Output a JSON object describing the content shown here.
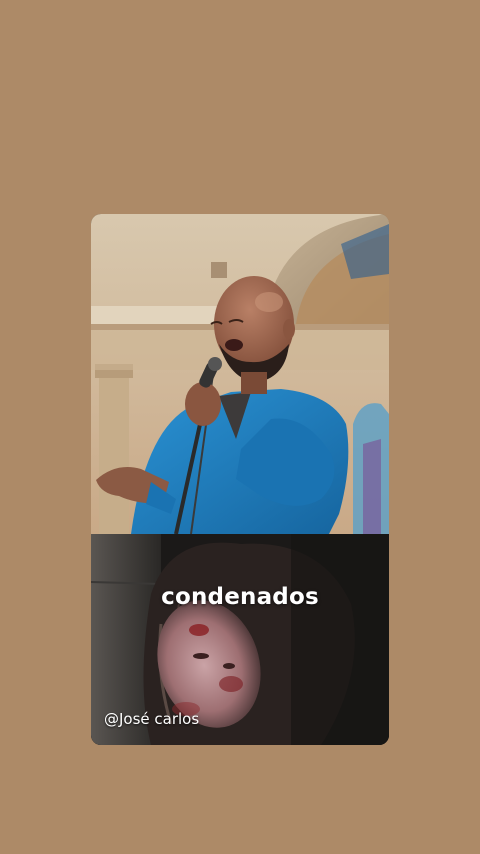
{
  "story": {
    "caption": "condenados",
    "watermark": "@José carlos"
  },
  "colors": {
    "background": "#ad8a67",
    "suit": "#1f7fbf",
    "caption_text": "#ffffff"
  },
  "icons": {
    "singer_image": "singer-with-microphone-photo",
    "bottom_image": "wounded-face-film-still"
  }
}
